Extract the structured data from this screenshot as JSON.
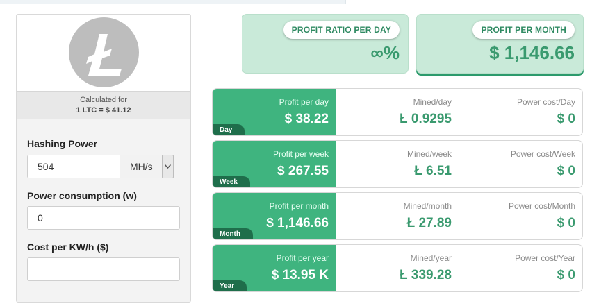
{
  "coin": {
    "logo_icon": "litecoin-logo-icon",
    "logo_glyph": "Ł",
    "calculated_for": "Calculated for",
    "rate": "1 LTC = $ 41.12"
  },
  "form": {
    "hashing_label": "Hashing Power",
    "hashing_value": "504",
    "hashing_unit": "MH/s",
    "power_label": "Power consumption (w)",
    "power_value": "0",
    "cost_label": "Cost per KW/h ($)",
    "cost_value": ""
  },
  "summary": {
    "ratio_label": "PROFIT RATIO PER DAY",
    "ratio_value": "∞%",
    "month_label": "PROFIT PER MONTH",
    "month_value": "$ 1,146.66"
  },
  "rows": [
    {
      "tag": "Day",
      "profit_label": "Profit per day",
      "profit_value": "$ 38.22",
      "mined_label": "Mined/day",
      "mined_value": "Ł 0.9295",
      "power_label": "Power cost/Day",
      "power_value": "$ 0"
    },
    {
      "tag": "Week",
      "profit_label": "Profit per week",
      "profit_value": "$ 267.55",
      "mined_label": "Mined/week",
      "mined_value": "Ł 6.51",
      "power_label": "Power cost/Week",
      "power_value": "$ 0"
    },
    {
      "tag": "Month",
      "profit_label": "Profit per month",
      "profit_value": "$ 1,146.66",
      "mined_label": "Mined/month",
      "mined_value": "Ł 27.89",
      "power_label": "Power cost/Month",
      "power_value": "$ 0"
    },
    {
      "tag": "Year",
      "profit_label": "Profit per year",
      "profit_value": "$ 13.95 K",
      "mined_label": "Mined/year",
      "mined_value": "Ł 339.28",
      "power_label": "Power cost/Year",
      "power_value": "$ 0"
    }
  ],
  "colors": {
    "accent_green": "#3fb47f",
    "dark_green": "#1f6e4b",
    "light_green": "#c9ead9",
    "value_green": "#3a9a6f"
  }
}
